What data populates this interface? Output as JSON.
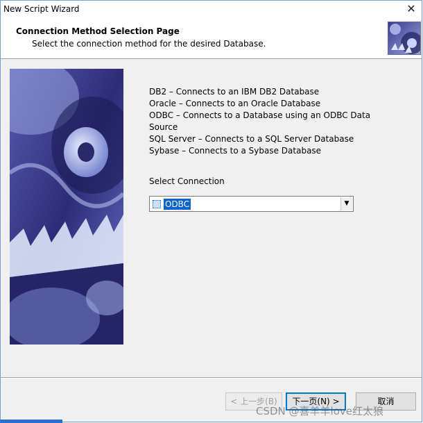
{
  "window": {
    "title": "New Script Wizard",
    "close_glyph": "✕"
  },
  "header": {
    "title": "Connection Method Selection Page",
    "subtitle": "Select the connection method for the desired Database."
  },
  "description": [
    "DB2 – Connects to an IBM DB2 Database",
    "Oracle – Connects to an Oracle Database",
    "ODBC – Connects to a Database using an ODBC Data Source",
    "SQL Server – Connects to a SQL Server Database",
    "Sybase – Connects to a Sybase Database"
  ],
  "connection": {
    "label": "Select Connection",
    "selected": "ODBC"
  },
  "buttons": {
    "back": "< 上一步(B)",
    "next": "下一页(N) >",
    "cancel": "取消"
  },
  "watermark": "CSDN @喜羊羊love红太狼",
  "colors": {
    "selection": "#0a64d8",
    "gear_dark": "#1e1e5a",
    "gear_light": "#c8d4ff"
  }
}
